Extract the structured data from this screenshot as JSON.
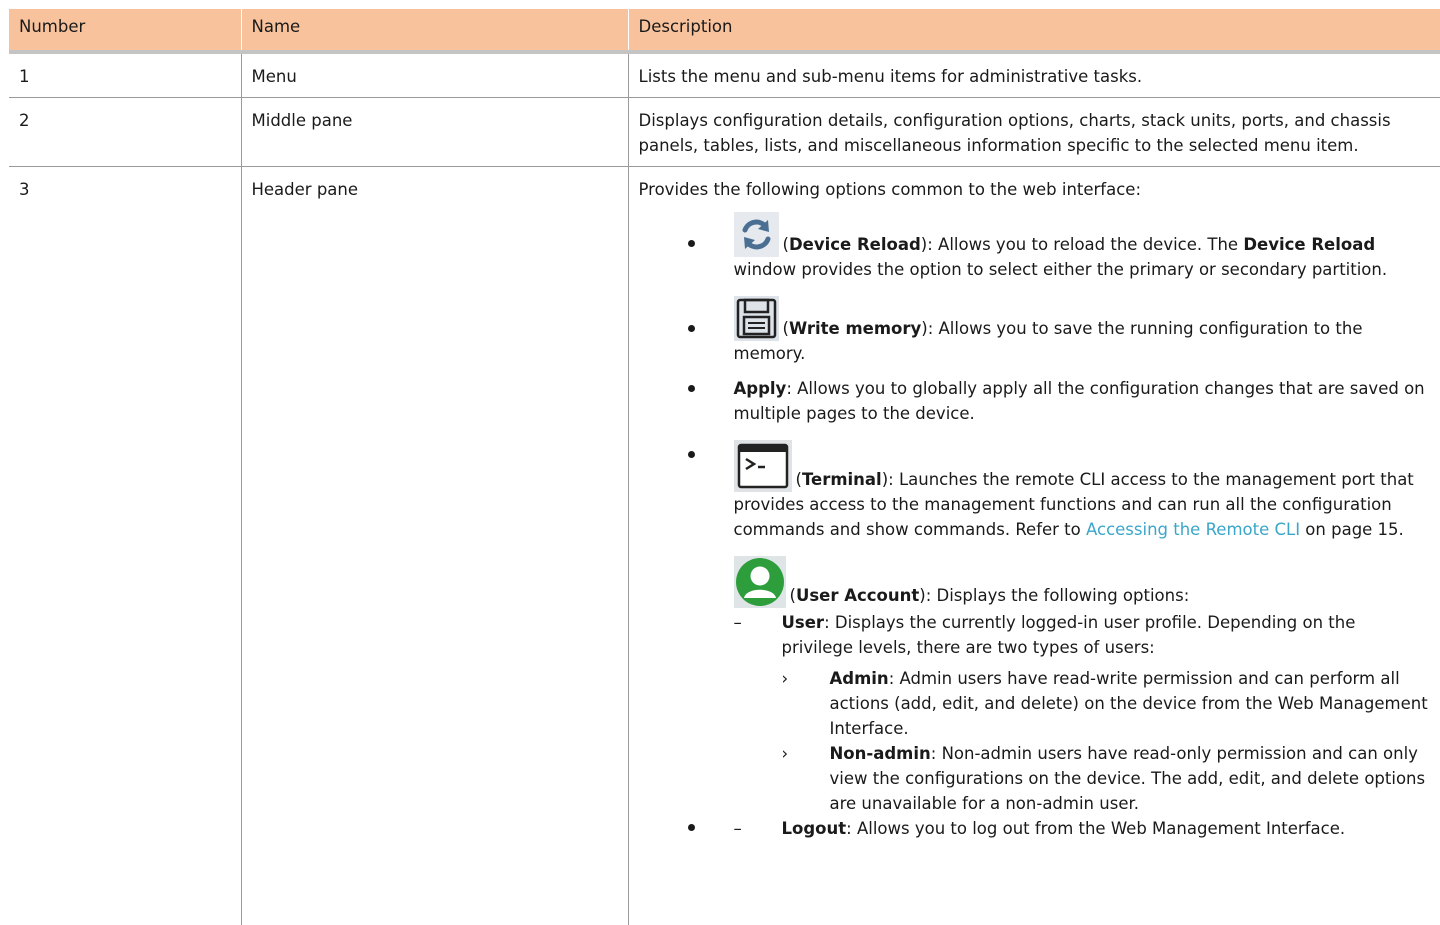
{
  "table": {
    "headers": [
      "Number",
      "Name",
      "Description"
    ],
    "rows": [
      {
        "number": "1",
        "name": "Menu",
        "description": "Lists the menu and sub-menu items for administrative tasks."
      },
      {
        "number": "2",
        "name": "Middle pane",
        "description": "Displays configuration details, configuration options, charts, stack units, ports, and chassis panels, tables, lists, and miscellaneous information specific to the selected menu item."
      },
      {
        "number": "3",
        "name": "Header pane",
        "description": "Provides the following options common to the web interface:"
      }
    ]
  },
  "header_options": {
    "reload": {
      "open": "(",
      "term": "Device Reload",
      "text1": "): Allows you to reload the device. The ",
      "term2": "Device Reload",
      "text2": " window provides the option to select either the primary or secondary partition."
    },
    "write": {
      "open": "(",
      "term": "Write memory",
      "text": "): Allows you to save the running configuration to the memory."
    },
    "apply": {
      "term": "Apply",
      "text": ": Allows you to globally apply all the configuration changes that are saved on multiple pages to the device."
    },
    "terminal": {
      "open": "(",
      "term": "Terminal",
      "text1": "): Launches the remote CLI access to the management port that provides access to the management functions and can run all the configuration commands and show commands. Refer to ",
      "link": "Accessing the Remote CLI",
      "text2": " on page 15."
    },
    "user_account": {
      "open": "(",
      "term": "User Account",
      "text": "): Displays the following options:"
    }
  },
  "user_options": {
    "user": {
      "term": "User",
      "text": ": Displays the currently logged-in user profile. Depending on the privilege levels, there are two types of users:"
    },
    "admin": {
      "term": "Admin",
      "text": ": Admin users have read-write permission and can perform all actions (add, edit, and delete) on the device from the Web Management Interface."
    },
    "non_admin": {
      "term": "Non-admin",
      "text": ": Non-admin users have read-only permission and can only view the configurations on the device. The add, edit, and delete options are unavailable for a non-admin user."
    },
    "logout": {
      "term": "Logout",
      "text": ": Allows you to log out from the Web Management Interface."
    }
  },
  "colors": {
    "header_bg": "#f8c29d",
    "link": "#3ba6c9",
    "user_icon": "#2e9e3c",
    "icon_bg": "#dde3e8"
  },
  "icons": [
    "refresh-icon",
    "save-icon",
    "terminal-icon",
    "user-account-icon"
  ]
}
